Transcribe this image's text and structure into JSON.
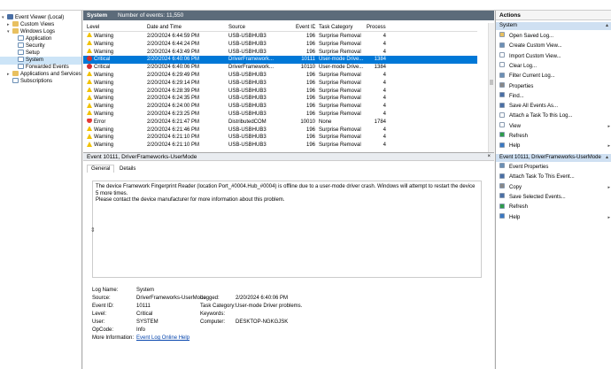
{
  "tree": {
    "items": [
      {
        "label": "Event Viewer (Local)",
        "icon": "event-viewer-icon",
        "indent": 0,
        "expander": "▾"
      },
      {
        "label": "Custom Views",
        "icon": "folder-icon",
        "indent": 1,
        "expander": "▸"
      },
      {
        "label": "Windows Logs",
        "icon": "folder-icon",
        "indent": 1,
        "expander": "▾"
      },
      {
        "label": "Application",
        "icon": "log-icon",
        "indent": 2,
        "expander": ""
      },
      {
        "label": "Security",
        "icon": "log-icon",
        "indent": 2,
        "expander": ""
      },
      {
        "label": "Setup",
        "icon": "log-icon",
        "indent": 2,
        "expander": ""
      },
      {
        "label": "System",
        "icon": "log-icon",
        "indent": 2,
        "expander": "",
        "selected": true
      },
      {
        "label": "Forwarded Events",
        "icon": "log-icon",
        "indent": 2,
        "expander": ""
      },
      {
        "label": "Applications and Services Logs",
        "icon": "folder-icon",
        "indent": 1,
        "expander": "▸"
      },
      {
        "label": "Subscriptions",
        "icon": "log-icon",
        "indent": 1,
        "expander": ""
      }
    ]
  },
  "log": {
    "name": "System",
    "count_text": "Number of events: 11,550"
  },
  "grid": {
    "columns": [
      "Level",
      "Date and Time",
      "Source",
      "Event ID",
      "Task Category",
      "Process ID"
    ],
    "rows": [
      {
        "level": "Warning",
        "date": "2/20/2024 6:44:59 PM",
        "source": "USB-USBHUB3",
        "id": "196",
        "task": "Surprise Removal",
        "pid": "4"
      },
      {
        "level": "Warning",
        "date": "2/20/2024 6:44:24 PM",
        "source": "USB-USBHUB3",
        "id": "196",
        "task": "Surprise Removal",
        "pid": "4"
      },
      {
        "level": "Warning",
        "date": "2/20/2024 6:43:49 PM",
        "source": "USB-USBHUB3",
        "id": "196",
        "task": "Surprise Removal",
        "pid": "4"
      },
      {
        "level": "Critical",
        "date": "2/20/2024 6:40:06 PM",
        "source": "DriverFramework...",
        "id": "10111",
        "task": "User-mode Drive...",
        "pid": "1384",
        "selected": true
      },
      {
        "level": "Critical",
        "date": "2/20/2024 6:40:06 PM",
        "source": "DriverFramework...",
        "id": "10110",
        "task": "User-mode Drive...",
        "pid": "1384"
      },
      {
        "level": "Warning",
        "date": "2/20/2024 6:29:49 PM",
        "source": "USB-USBHUB3",
        "id": "196",
        "task": "Surprise Removal",
        "pid": "4"
      },
      {
        "level": "Warning",
        "date": "2/20/2024 6:29:14 PM",
        "source": "USB-USBHUB3",
        "id": "196",
        "task": "Surprise Removal",
        "pid": "4"
      },
      {
        "level": "Warning",
        "date": "2/20/2024 6:28:39 PM",
        "source": "USB-USBHUB3",
        "id": "196",
        "task": "Surprise Removal",
        "pid": "4"
      },
      {
        "level": "Warning",
        "date": "2/20/2024 6:24:35 PM",
        "source": "USB-USBHUB3",
        "id": "196",
        "task": "Surprise Removal",
        "pid": "4"
      },
      {
        "level": "Warning",
        "date": "2/20/2024 6:24:00 PM",
        "source": "USB-USBHUB3",
        "id": "196",
        "task": "Surprise Removal",
        "pid": "4"
      },
      {
        "level": "Warning",
        "date": "2/20/2024 6:23:25 PM",
        "source": "USB-USBHUB3",
        "id": "196",
        "task": "Surprise Removal",
        "pid": "4"
      },
      {
        "level": "Error",
        "date": "2/20/2024 6:21:47 PM",
        "source": "DistributedCOM",
        "id": "10010",
        "task": "None",
        "pid": "1784"
      },
      {
        "level": "Warning",
        "date": "2/20/2024 6:21:46 PM",
        "source": "USB-USBHUB3",
        "id": "196",
        "task": "Surprise Removal",
        "pid": "4"
      },
      {
        "level": "Warning",
        "date": "2/20/2024 6:21:10 PM",
        "source": "USB-USBHUB3",
        "id": "196",
        "task": "Surprise Removal",
        "pid": "4"
      },
      {
        "level": "Warning",
        "date": "2/20/2024 6:21:10 PM",
        "source": "USB-USBHUB3",
        "id": "196",
        "task": "Surprise Removal",
        "pid": "4"
      }
    ]
  },
  "detail": {
    "header": "Event 10111, DriverFrameworks-UserMode",
    "close": "×",
    "tabs": [
      "General",
      "Details"
    ],
    "description_1": "The device Framework Fingerprint Reader (location Port_#0004.Hub_#0004) is offline due to a user-mode driver crash.  Windows will attempt to restart the device 5 more times.",
    "description_2": "Please contact the device manufacturer for more information about this problem.",
    "props": {
      "log_name_label": "Log Name:",
      "log_name": "System",
      "source_label": "Source:",
      "source": "DriverFrameworks-UserMode",
      "logged_label": "Logged:",
      "logged": "2/20/2024 6:40:06 PM",
      "event_id_label": "Event ID:",
      "event_id": "10111",
      "task_label": "Task Category:",
      "task": "User-mode Driver problems.",
      "level_label": "Level:",
      "level": "Critical",
      "keywords_label": "Keywords:",
      "keywords": "",
      "user_label": "User:",
      "user": "SYSTEM",
      "computer_label": "Computer:",
      "computer": "DESKTOP-NGKGJSK",
      "opcode_label": "OpCode:",
      "opcode": "Info",
      "more_label": "More Information:",
      "more_link": "Event Log Online Help"
    }
  },
  "actions": {
    "title": "Actions",
    "section1": "System",
    "section1_items": [
      {
        "label": "Open Saved Log...",
        "icon": "open-log-icon",
        "color": "#e8c060"
      },
      {
        "label": "Create Custom View...",
        "icon": "filter-icon",
        "color": "#6b8fb5"
      },
      {
        "label": "Import Custom View...",
        "icon": "import-icon",
        "color": "#ffffff"
      },
      {
        "label": "Clear Log...",
        "icon": "clear-icon",
        "color": "#ffffff"
      },
      {
        "label": "Filter Current Log...",
        "icon": "filter-icon",
        "color": "#6b8fb5"
      },
      {
        "label": "Properties",
        "icon": "properties-icon",
        "color": "#888888"
      },
      {
        "label": "Find...",
        "icon": "find-icon",
        "color": "#4a6fa5"
      },
      {
        "label": "Save All Events As...",
        "icon": "save-icon",
        "color": "#4a6fa5"
      },
      {
        "label": "Attach a Task To this Log...",
        "icon": "task-icon",
        "color": "#ffffff"
      },
      {
        "label": "View",
        "icon": "view-icon",
        "color": "#ffffff",
        "sub": "▸"
      },
      {
        "label": "Refresh",
        "icon": "refresh-icon",
        "color": "#2e9c4a"
      },
      {
        "label": "Help",
        "icon": "help-icon",
        "color": "#3a78c2",
        "sub": "▸"
      }
    ],
    "section2": "Event 10111, DriverFrameworks-UserMode",
    "section2_items": [
      {
        "label": "Event Properties",
        "icon": "event-properties-icon",
        "color": "#6b8fb5"
      },
      {
        "label": "Attach Task To This Event...",
        "icon": "task-icon",
        "color": "#4a6fa5"
      },
      {
        "label": "Copy",
        "icon": "copy-icon",
        "color": "#888888",
        "sub": "▸"
      },
      {
        "label": "Save Selected Events...",
        "icon": "save-icon",
        "color": "#4a6fa5"
      },
      {
        "label": "Refresh",
        "icon": "refresh-icon",
        "color": "#2e9c4a"
      },
      {
        "label": "Help",
        "icon": "help-icon",
        "color": "#3a78c2",
        "sub": "▸"
      }
    ],
    "collapse": "▴"
  }
}
